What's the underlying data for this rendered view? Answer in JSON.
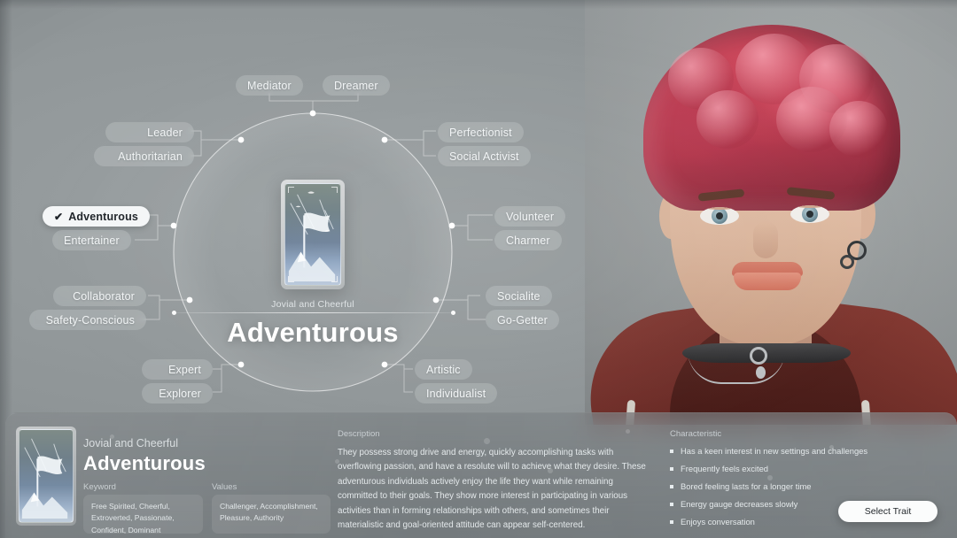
{
  "colors": {
    "background": "#8d9295",
    "pill_bg": "rgba(236,240,242,0.20)",
    "pill_selected_bg": "#f4f6f7",
    "accent_text": "#ffffff",
    "hair": "#d64a5f",
    "hoodie": "#7e9aa0",
    "hood_lining": "#7b312a"
  },
  "center": {
    "subtitle": "Jovial and Cheerful",
    "title": "Adventurous",
    "card_icon": "flag-on-mountain-card"
  },
  "traits": [
    {
      "label": "Mediator",
      "selected": false,
      "group": "top"
    },
    {
      "label": "Dreamer",
      "selected": false,
      "group": "top"
    },
    {
      "label": "Leader",
      "selected": false,
      "group": "upper-left"
    },
    {
      "label": "Authoritarian",
      "selected": false,
      "group": "upper-left"
    },
    {
      "label": "Adventurous",
      "selected": true,
      "group": "left"
    },
    {
      "label": "Entertainer",
      "selected": false,
      "group": "left"
    },
    {
      "label": "Collaborator",
      "selected": false,
      "group": "lower-left"
    },
    {
      "label": "Safety-Conscious",
      "selected": false,
      "group": "lower-left"
    },
    {
      "label": "Expert",
      "selected": false,
      "group": "bottom-left"
    },
    {
      "label": "Explorer",
      "selected": false,
      "group": "bottom-left"
    },
    {
      "label": "Perfectionist",
      "selected": false,
      "group": "upper-right"
    },
    {
      "label": "Social Activist",
      "selected": false,
      "group": "upper-right"
    },
    {
      "label": "Volunteer",
      "selected": false,
      "group": "right"
    },
    {
      "label": "Charmer",
      "selected": false,
      "group": "right"
    },
    {
      "label": "Socialite",
      "selected": false,
      "group": "lower-right"
    },
    {
      "label": "Go-Getter",
      "selected": false,
      "group": "lower-right"
    },
    {
      "label": "Artistic",
      "selected": false,
      "group": "bottom-right"
    },
    {
      "label": "Individualist",
      "selected": false,
      "group": "bottom-right"
    }
  ],
  "selected_marker": "✔",
  "detail": {
    "subtitle": "Jovial and Cheerful",
    "title": "Adventurous",
    "keyword_label": "Keyword",
    "keyword_value": "Free Spirited, Cheerful, Extroverted, Passionate, Confident, Dominant",
    "values_label": "Values",
    "values_value": "Challenger, Accomplishment, Pleasure, Authority",
    "description_label": "Description",
    "description_text": "They possess strong drive and energy, quickly accomplishing tasks with overflowing passion, and have a resolute will to achieve what they desire. These adventurous individuals actively enjoy the life they want while remaining committed to their goals. They show more interest in participating in various activities than in forming relationships with others, and sometimes their materialistic and goal-oriented attitude can appear self-centered.",
    "characteristic_label": "Characteristic",
    "characteristics": [
      "Has a keen interest in new settings and challenges",
      "Frequently feels excited",
      "Bored feeling lasts for a longer time",
      "Energy gauge decreases slowly",
      "Enjoys conversation"
    ],
    "select_button": "Select Trait"
  }
}
